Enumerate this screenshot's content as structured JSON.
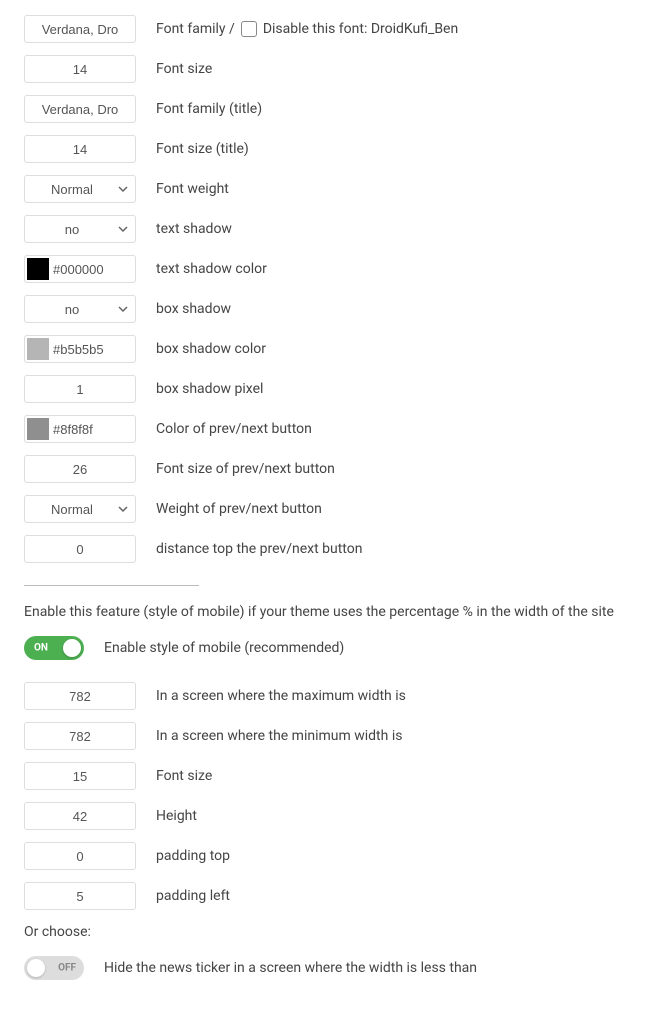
{
  "rows1": [
    {
      "value": "Verdana, Dro",
      "label_pre": "Font family /",
      "checkbox": true,
      "label_post": "Disable this font: DroidKufi_Ben"
    },
    {
      "value": "14",
      "label": "Font size"
    },
    {
      "value": "Verdana, Dro",
      "label": "Font family (title)"
    },
    {
      "value": "14",
      "label": "Font size (title)"
    },
    {
      "type": "select",
      "value": "Normal",
      "label": "Font weight"
    },
    {
      "type": "select",
      "value": "no",
      "label": "text shadow"
    },
    {
      "type": "color",
      "swatch": "#000000",
      "value": "#000000",
      "label": "text shadow color"
    },
    {
      "type": "select",
      "value": "no",
      "label": "box shadow"
    },
    {
      "type": "color",
      "swatch": "#b5b5b5",
      "value": "#b5b5b5",
      "label": "box shadow color"
    },
    {
      "value": "1",
      "label": "box shadow pixel"
    },
    {
      "type": "color",
      "swatch": "#8f8f8f",
      "value": "#8f8f8f",
      "label": "Color of prev/next button"
    },
    {
      "value": "26",
      "label": "Font size of prev/next button"
    },
    {
      "type": "select",
      "value": "Normal",
      "label": "Weight of prev/next button"
    },
    {
      "value": "0",
      "label": "distance top the prev/next button"
    }
  ],
  "mobile_section_text": "Enable this feature (style of mobile) if your theme uses the percentage % in the width of the site",
  "toggle1": {
    "state": "on",
    "stateLabel": "ON",
    "label": "Enable style of mobile (recommended)"
  },
  "rows2": [
    {
      "value": "782",
      "label": "In a screen where the maximum width is"
    },
    {
      "value": "782",
      "label": "In a screen where the minimum width is"
    },
    {
      "value": "15",
      "label": "Font size"
    },
    {
      "value": "42",
      "label": "Height"
    },
    {
      "value": "0",
      "label": "padding top"
    },
    {
      "value": "5",
      "label": "padding left"
    }
  ],
  "or_choose": "Or choose:",
  "toggle2": {
    "state": "off",
    "stateLabel": "OFF",
    "label": "Hide the news ticker in a screen where the width is less than"
  }
}
